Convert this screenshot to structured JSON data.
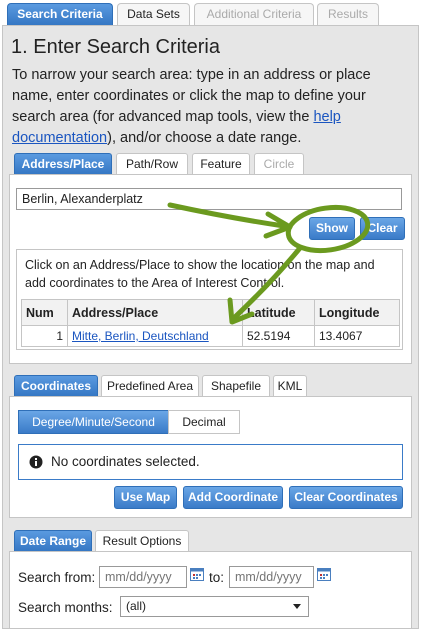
{
  "top_tabs": [
    {
      "label": "Search Criteria"
    },
    {
      "label": "Data Sets"
    },
    {
      "label": "Additional Criteria"
    },
    {
      "label": "Results"
    }
  ],
  "step": {
    "title": "1. Enter Search Criteria",
    "intro_before_link": "To narrow your search area: type in an address or place name, enter coordinates or click the map to define your search area (for advanced map tools, view the ",
    "intro_link": "help documentation",
    "intro_after_link": "), and/or choose a date range."
  },
  "search_tabs": [
    {
      "label": "Address/Place"
    },
    {
      "label": "Path/Row"
    },
    {
      "label": "Feature"
    },
    {
      "label": "Circle"
    }
  ],
  "address": {
    "input_value": "Berlin, Alexanderplatz",
    "show_label": "Show",
    "clear_label": "Clear",
    "hint": "Click on an Address/Place to show the location on the map and add coordinates to the Area of Interest Control."
  },
  "results_table": {
    "headers": [
      "Num",
      "Address/Place",
      "Latitude",
      "Longitude"
    ],
    "rows": [
      {
        "num": "1",
        "place": "Mitte, Berlin, Deutschland",
        "lat": "52.5194",
        "lon": "13.4067"
      }
    ]
  },
  "coord_tabs": [
    {
      "label": "Coordinates"
    },
    {
      "label": "Predefined Area"
    },
    {
      "label": "Shapefile"
    },
    {
      "label": "KML"
    }
  ],
  "coords": {
    "format_dms": "Degree/Minute/Second",
    "format_decimal": "Decimal",
    "message": "No coordinates selected.",
    "use_map": "Use Map",
    "add_coordinate": "Add Coordinate",
    "clear_coordinates": "Clear Coordinates"
  },
  "date_tabs": [
    {
      "label": "Date Range"
    },
    {
      "label": "Result Options"
    }
  ],
  "date": {
    "from_label": "Search from:",
    "from_placeholder": "mm/dd/yyyy",
    "to_label": "to:",
    "to_placeholder": "mm/dd/yyyy",
    "months_label": "Search months:",
    "months_value": "(all)"
  },
  "colors": {
    "accent": "#3a7bc8",
    "annotation_green": "#6b9a1f",
    "link": "#1a55c0"
  },
  "icons": [
    "calendar-icon",
    "info-icon",
    "chevron-down-icon"
  ]
}
